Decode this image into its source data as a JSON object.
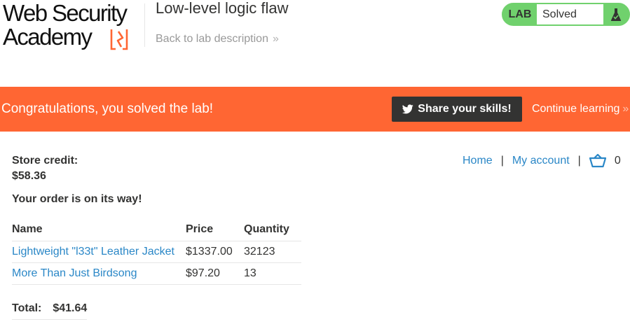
{
  "brand": {
    "line1": "Web Security",
    "line2": "Academy"
  },
  "header": {
    "lab_title": "Low-level logic flaw",
    "back_link": "Back to lab description",
    "lab_badge": "LAB",
    "lab_status": "Solved"
  },
  "banner": {
    "message": "Congratulations, you solved the lab!",
    "share_label": "Share your skills!",
    "continue_label": "Continue learning"
  },
  "account": {
    "credit_label": "Store credit:",
    "credit_value": "$58.36"
  },
  "nav": {
    "home": "Home",
    "sep1": "|",
    "my_account": "My account",
    "sep2": "|",
    "cart_count": "0"
  },
  "order": {
    "message": "Your order is on its way!",
    "columns": [
      "Name",
      "Price",
      "Quantity"
    ],
    "rows": [
      {
        "name": "Lightweight \"l33t\" Leather Jacket",
        "price": "$1337.00",
        "quantity": "32123"
      },
      {
        "name": "More Than Just Birdsong",
        "price": "$97.20",
        "quantity": "13"
      }
    ],
    "total_label": "Total:",
    "total_value": "$41.64"
  },
  "icons": {
    "brand_mark": "lightning-bolt-icon",
    "lab_flask": "flask-icon",
    "twitter": "twitter-bird-icon",
    "cart": "basket-icon",
    "chevrons": "double-chevron-right-icon"
  },
  "colors": {
    "banner": "#ff6633",
    "solved": "#70d16d",
    "link": "#2a87c7",
    "share_button": "#333332"
  }
}
